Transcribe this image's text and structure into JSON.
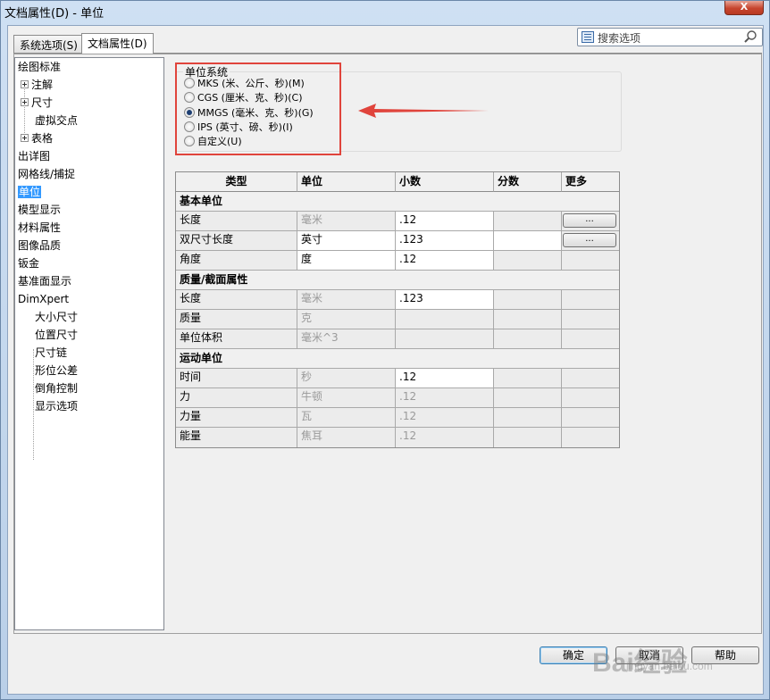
{
  "window": {
    "title": "文档属性(D) - 单位",
    "close_label": "X"
  },
  "tabs": [
    {
      "label": "系统选项(S)",
      "active": false
    },
    {
      "label": "文档属性(D)",
      "active": true
    }
  ],
  "search": {
    "placeholder": "搜索选项"
  },
  "tree": [
    {
      "label": "绘图标准",
      "level": 0,
      "expandable": false,
      "selected": false
    },
    {
      "label": "注解",
      "level": 1,
      "expandable": true,
      "selected": false
    },
    {
      "label": "尺寸",
      "level": 1,
      "expandable": true,
      "selected": false
    },
    {
      "label": "虚拟交点",
      "level": 2,
      "expandable": false,
      "selected": false
    },
    {
      "label": "表格",
      "level": 1,
      "expandable": true,
      "selected": false
    },
    {
      "label": "出详图",
      "level": 0,
      "expandable": false,
      "selected": false
    },
    {
      "label": "网格线/捕捉",
      "level": 0,
      "expandable": false,
      "selected": false
    },
    {
      "label": "单位",
      "level": 0,
      "expandable": false,
      "selected": true
    },
    {
      "label": "模型显示",
      "level": 0,
      "expandable": false,
      "selected": false
    },
    {
      "label": "材料属性",
      "level": 0,
      "expandable": false,
      "selected": false
    },
    {
      "label": "图像品质",
      "level": 0,
      "expandable": false,
      "selected": false
    },
    {
      "label": "钣金",
      "level": 0,
      "expandable": false,
      "selected": false
    },
    {
      "label": "基准面显示",
      "level": 0,
      "expandable": false,
      "selected": false
    },
    {
      "label": "DimXpert",
      "level": 0,
      "expandable": false,
      "selected": false
    },
    {
      "label": "大小尺寸",
      "level": 2,
      "expandable": false,
      "selected": false
    },
    {
      "label": "位置尺寸",
      "level": 2,
      "expandable": false,
      "selected": false
    },
    {
      "label": "尺寸链",
      "level": 2,
      "expandable": false,
      "selected": false
    },
    {
      "label": "形位公差",
      "level": 2,
      "expandable": false,
      "selected": false
    },
    {
      "label": "倒角控制",
      "level": 2,
      "expandable": false,
      "selected": false
    },
    {
      "label": "显示选项",
      "level": 2,
      "expandable": false,
      "selected": false
    }
  ],
  "unit_system": {
    "title": "单位系统",
    "options": [
      {
        "label": "MKS (米、公斤、秒)(M)",
        "checked": false
      },
      {
        "label": "CGS (厘米、克、秒)(C)",
        "checked": false
      },
      {
        "label": "MMGS (毫米、克、秒)(G)",
        "checked": true
      },
      {
        "label": "IPS (英寸、磅、秒)(I)",
        "checked": false
      },
      {
        "label": "自定义(U)",
        "checked": false
      }
    ]
  },
  "table": {
    "headers": [
      "类型",
      "单位",
      "小数",
      "分数",
      "更多"
    ],
    "sections": [
      {
        "title": "基本单位",
        "rows": [
          {
            "type": "长度",
            "unit": "毫米",
            "decimal": ".12",
            "fraction": "",
            "more": "...",
            "unit_enabled": false,
            "decimal_enabled": true,
            "fraction_enabled": false
          },
          {
            "type": "双尺寸长度",
            "unit": "英寸",
            "decimal": ".123",
            "fraction": "",
            "more": "...",
            "unit_enabled": true,
            "decimal_enabled": true,
            "fraction_enabled": true
          },
          {
            "type": "角度",
            "unit": "度",
            "decimal": ".12",
            "fraction": "",
            "more": "",
            "unit_enabled": true,
            "decimal_enabled": true,
            "fraction_enabled": false
          }
        ]
      },
      {
        "title": "质量/截面属性",
        "rows": [
          {
            "type": "长度",
            "unit": "毫米",
            "decimal": ".123",
            "fraction": "",
            "more": "",
            "unit_enabled": false,
            "decimal_enabled": true,
            "fraction_enabled": false
          },
          {
            "type": "质量",
            "unit": "克",
            "decimal": "",
            "fraction": "",
            "more": "",
            "unit_enabled": false,
            "decimal_enabled": false,
            "fraction_enabled": false
          },
          {
            "type": "单位体积",
            "unit": "毫米^3",
            "decimal": "",
            "fraction": "",
            "more": "",
            "unit_enabled": false,
            "decimal_enabled": false,
            "fraction_enabled": false
          }
        ]
      },
      {
        "title": "运动单位",
        "rows": [
          {
            "type": "时间",
            "unit": "秒",
            "decimal": ".12",
            "fraction": "",
            "more": "",
            "unit_enabled": false,
            "decimal_enabled": true,
            "fraction_enabled": false
          },
          {
            "type": "力",
            "unit": "牛顿",
            "decimal": ".12",
            "fraction": "",
            "more": "",
            "unit_enabled": false,
            "decimal_enabled": false,
            "fraction_enabled": false
          },
          {
            "type": "力量",
            "unit": "瓦",
            "decimal": ".12",
            "fraction": "",
            "more": "",
            "unit_enabled": false,
            "decimal_enabled": false,
            "fraction_enabled": false
          },
          {
            "type": "能量",
            "unit": "焦耳",
            "decimal": ".12",
            "fraction": "",
            "more": "",
            "unit_enabled": false,
            "decimal_enabled": false,
            "fraction_enabled": false
          }
        ]
      }
    ]
  },
  "buttons": {
    "ok": "确定",
    "cancel": "取消",
    "help": "帮助"
  },
  "watermark": {
    "text": "Bai经验",
    "sub": "jingyan.baidu.com"
  },
  "colors": {
    "highlight": "#e0443c",
    "selection": "#3399ff",
    "arrow": "#e0443c"
  }
}
